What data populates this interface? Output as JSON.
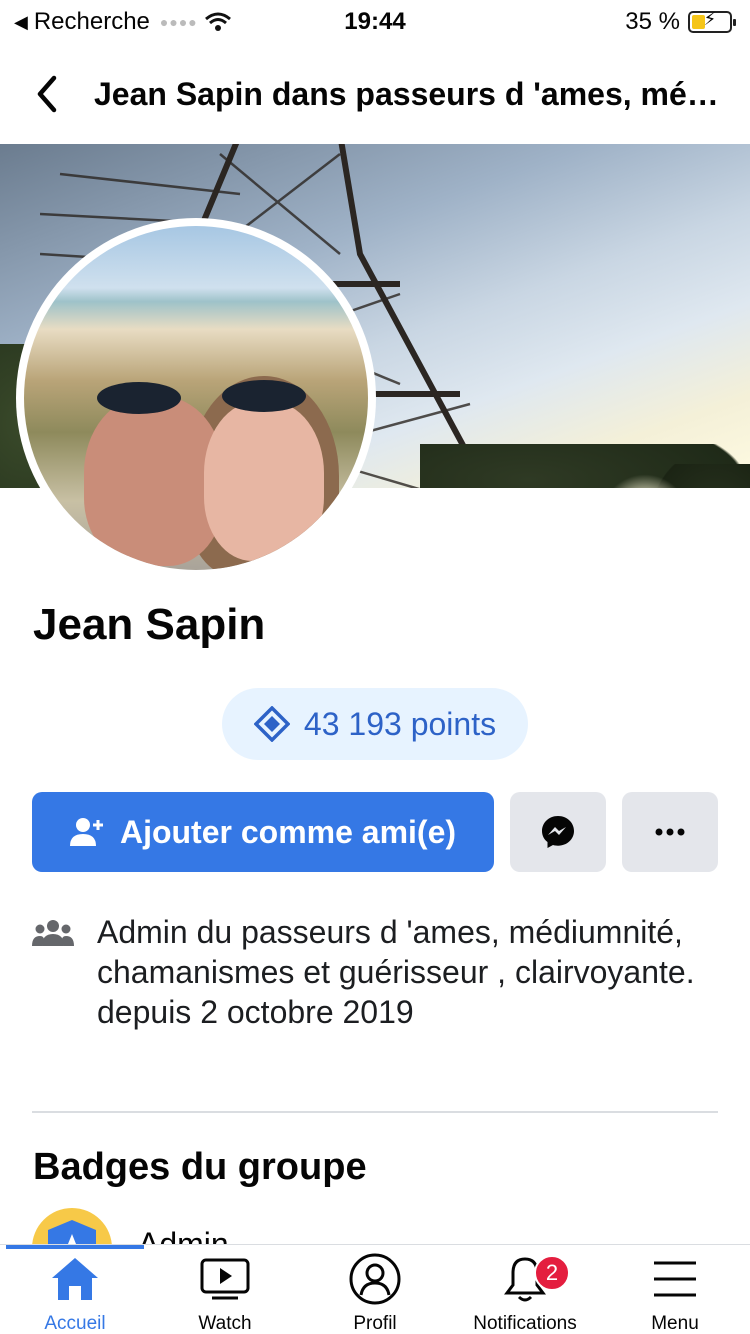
{
  "status_bar": {
    "carrier": "Recherche",
    "time": "19:44",
    "battery_percent": "35 %"
  },
  "header": {
    "title": "Jean Sapin dans passeurs d 'ames, médiumnité, chamanismes et guérisseur , clairvoyante."
  },
  "profile": {
    "name": "Jean Sapin",
    "points": "43 193 points"
  },
  "actions": {
    "add_friend_label": "Ajouter comme ami(e)"
  },
  "info": {
    "prefix": "Admin du ",
    "group": "passeurs d 'ames, médiumnité, chamanismes et guérisseur , clairvoyante.",
    "suffix": " depuis 2 octobre 2019"
  },
  "badges": {
    "title": "Badges du groupe",
    "items": [
      {
        "label": "Admin"
      }
    ]
  },
  "tabbar": {
    "items": [
      {
        "label": "Accueil",
        "icon": "home-icon",
        "active": true
      },
      {
        "label": "Watch",
        "icon": "watch-icon"
      },
      {
        "label": "Profil",
        "icon": "profile-icon"
      },
      {
        "label": "Notifications",
        "icon": "bell-icon",
        "badge": "2"
      },
      {
        "label": "Menu",
        "icon": "menu-icon"
      }
    ]
  },
  "colors": {
    "accent": "#3578e5",
    "points_text": "#2d62c7",
    "points_bg": "#e7f3ff",
    "notif_badge": "#e41e3f"
  }
}
